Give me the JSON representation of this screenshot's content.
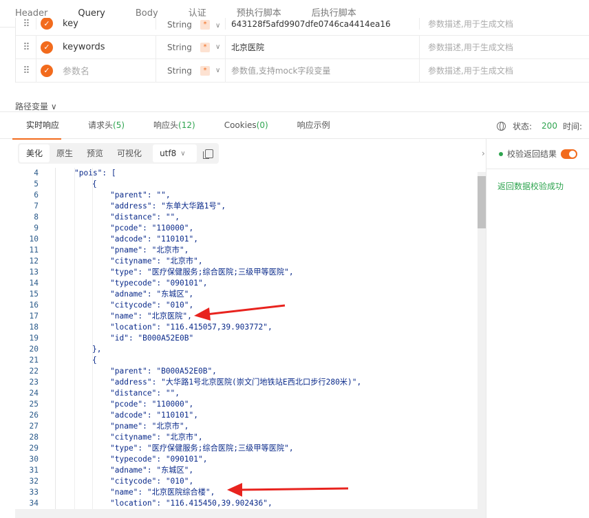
{
  "top_tabs": [
    "Header",
    "Query",
    "Body",
    "认证",
    "预执行脚本",
    "后执行脚本"
  ],
  "params": [
    {
      "name": "key",
      "type": "String",
      "required": "*",
      "value": "643128f5afd9907dfe0746ca4414ea16",
      "desc": "参数描述,用于生成文档"
    },
    {
      "name": "keywords",
      "type": "String",
      "required": "*",
      "value": "北京医院",
      "desc": "参数描述,用于生成文档"
    },
    {
      "name": "参数名",
      "type": "String",
      "required": "*",
      "value": "参数值,支持mock字段变量",
      "desc": "参数描述,用于生成文档"
    }
  ],
  "path_var_label": "路径变量",
  "resp_tabs": [
    {
      "label": "实时响应",
      "count": ""
    },
    {
      "label": "请求头",
      "count": "(5)"
    },
    {
      "label": "响应头",
      "count": "(12)"
    },
    {
      "label": "Cookies",
      "count": "(0)"
    },
    {
      "label": "响应示例",
      "count": ""
    }
  ],
  "status": {
    "label": "状态:",
    "code": "200",
    "time_label": "时间:"
  },
  "toolbar": {
    "beautify": "美化",
    "raw": "原生",
    "preview": "预览",
    "visualize": "可视化",
    "encoding": "utf8"
  },
  "right_panel": {
    "verify_label": "校验返回结果",
    "verify_ok": "返回数据校验成功"
  },
  "code_lines": [
    {
      "n": "4",
      "t": "\"pois\": [",
      "i": 0
    },
    {
      "n": "5",
      "t": "{",
      "i": 1
    },
    {
      "n": "6",
      "t": "\"parent\": \"\",",
      "i": 2
    },
    {
      "n": "7",
      "t": "\"address\": \"东单大华路1号\",",
      "i": 2
    },
    {
      "n": "8",
      "t": "\"distance\": \"\",",
      "i": 2
    },
    {
      "n": "9",
      "t": "\"pcode\": \"110000\",",
      "i": 2
    },
    {
      "n": "10",
      "t": "\"adcode\": \"110101\",",
      "i": 2
    },
    {
      "n": "11",
      "t": "\"pname\": \"北京市\",",
      "i": 2
    },
    {
      "n": "12",
      "t": "\"cityname\": \"北京市\",",
      "i": 2
    },
    {
      "n": "13",
      "t": "\"type\": \"医疗保健服务;综合医院;三级甲等医院\",",
      "i": 2
    },
    {
      "n": "14",
      "t": "\"typecode\": \"090101\",",
      "i": 2
    },
    {
      "n": "15",
      "t": "\"adname\": \"东城区\",",
      "i": 2
    },
    {
      "n": "16",
      "t": "\"citycode\": \"010\",",
      "i": 2
    },
    {
      "n": "17",
      "t": "\"name\": \"北京医院\",",
      "i": 2
    },
    {
      "n": "18",
      "t": "\"location\": \"116.415057,39.903772\",",
      "i": 2
    },
    {
      "n": "19",
      "t": "\"id\": \"B000A52E0B\"",
      "i": 2
    },
    {
      "n": "20",
      "t": "},",
      "i": 1
    },
    {
      "n": "21",
      "t": "{",
      "i": 1
    },
    {
      "n": "22",
      "t": "\"parent\": \"B000A52E0B\",",
      "i": 2
    },
    {
      "n": "23",
      "t": "\"address\": \"大华路1号北京医院(崇文门地铁站E西北口步行280米)\",",
      "i": 2
    },
    {
      "n": "24",
      "t": "\"distance\": \"\",",
      "i": 2
    },
    {
      "n": "25",
      "t": "\"pcode\": \"110000\",",
      "i": 2
    },
    {
      "n": "26",
      "t": "\"adcode\": \"110101\",",
      "i": 2
    },
    {
      "n": "27",
      "t": "\"pname\": \"北京市\",",
      "i": 2
    },
    {
      "n": "28",
      "t": "\"cityname\": \"北京市\",",
      "i": 2
    },
    {
      "n": "29",
      "t": "\"type\": \"医疗保健服务;综合医院;三级甲等医院\",",
      "i": 2
    },
    {
      "n": "30",
      "t": "\"typecode\": \"090101\",",
      "i": 2
    },
    {
      "n": "31",
      "t": "\"adname\": \"东城区\",",
      "i": 2
    },
    {
      "n": "32",
      "t": "\"citycode\": \"010\",",
      "i": 2
    },
    {
      "n": "33",
      "t": "\"name\": \"北京医院综合楼\",",
      "i": 2
    },
    {
      "n": "34",
      "t": "\"location\": \"116.415450,39.902436\",",
      "i": 2
    }
  ],
  "colors": {
    "accent": "#f26b1d",
    "success": "#2ea44f",
    "annotation": "#e8231e"
  }
}
